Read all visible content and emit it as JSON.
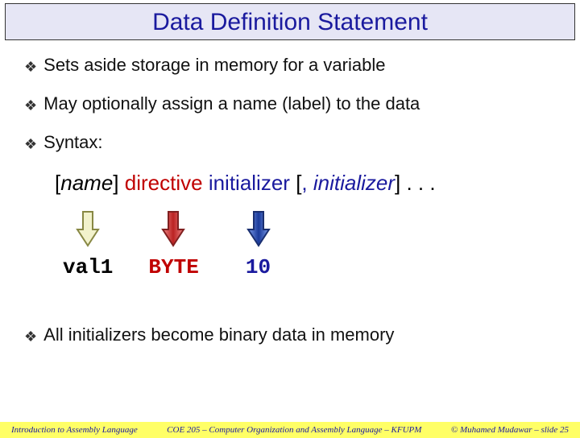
{
  "title": "Data Definition Statement",
  "bullets": {
    "b1": "Sets aside storage in memory for a variable",
    "b2": "May optionally assign a name (label) to the data",
    "b3": "Syntax:",
    "b4": "All initializers become binary data in memory"
  },
  "syntax": {
    "lbracket1": "[",
    "name": "name",
    "rbracket1": "]",
    "space": " ",
    "directive": "directive",
    "initializer": "initializer",
    "lbracket2": " [",
    "comma": ", ",
    "initializer2": "initializer",
    "rbracket2": "]",
    "dots": " . . ."
  },
  "example": {
    "v1": "val1",
    "v2": "BYTE",
    "v3": "10"
  },
  "footer": {
    "left": "Introduction to Assembly Language",
    "center": "COE 205 – Computer Organization and Assembly Language – KFUPM",
    "right": "© Muhamed Mudawar – slide 25"
  },
  "arrows": {
    "c1": {
      "fill": "#f2f2cc",
      "stroke": "#888844"
    },
    "c2": {
      "fill": "#d94a4a",
      "stroke": "#802020"
    },
    "c3": {
      "fill": "#3a5fc8",
      "stroke": "#1a2f70"
    }
  }
}
